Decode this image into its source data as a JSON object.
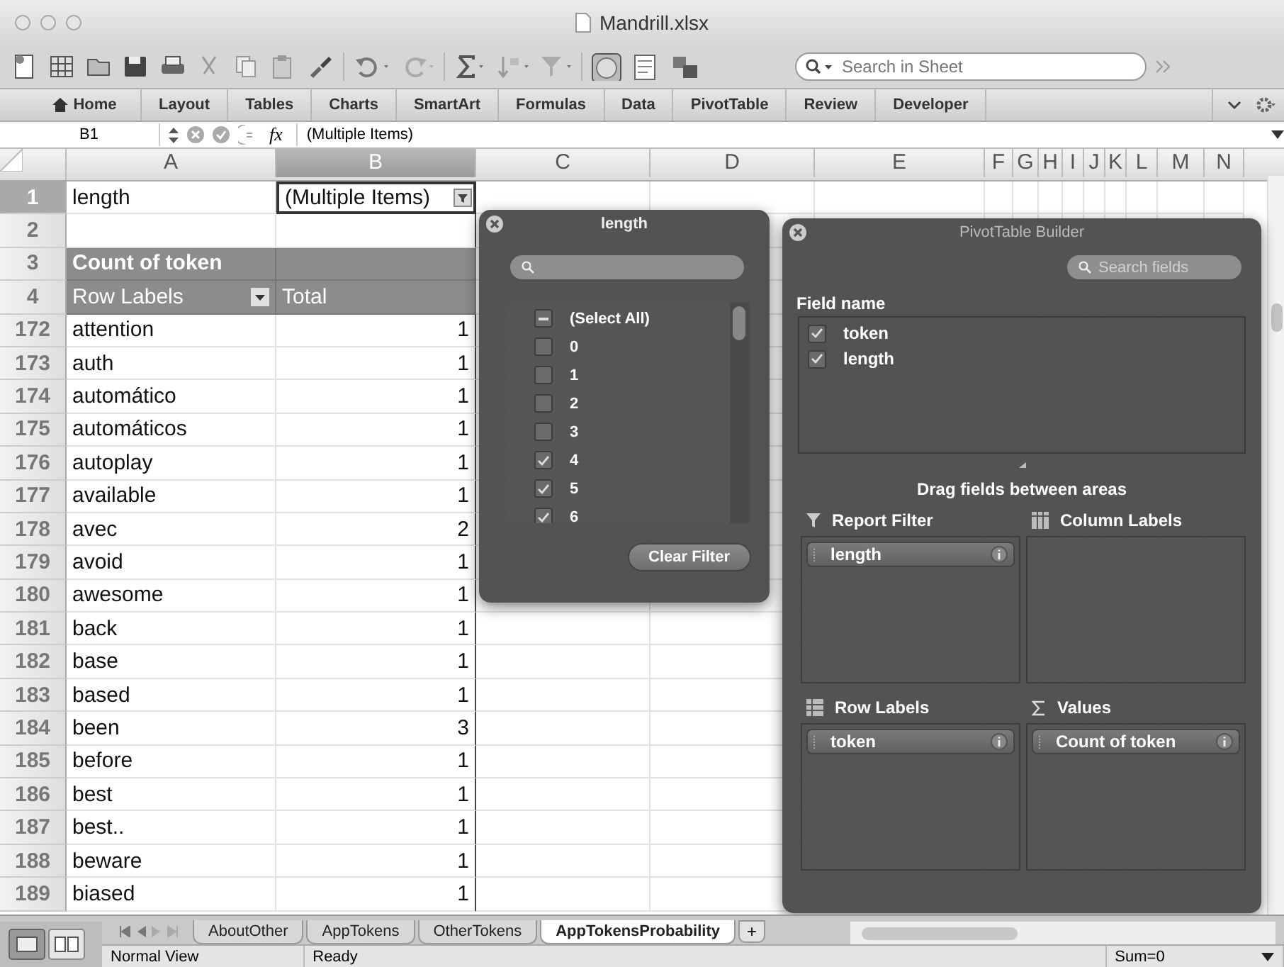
{
  "window": {
    "title": "Mandrill.xlsx"
  },
  "toolbar": {
    "search_placeholder": "Search in Sheet"
  },
  "ribbon": {
    "tabs": [
      {
        "label": "Home"
      },
      {
        "label": "Layout"
      },
      {
        "label": "Tables"
      },
      {
        "label": "Charts"
      },
      {
        "label": "SmartArt"
      },
      {
        "label": "Formulas"
      },
      {
        "label": "Data"
      },
      {
        "label": "PivotTable"
      },
      {
        "label": "Review"
      },
      {
        "label": "Developer"
      }
    ]
  },
  "formula_bar": {
    "name_box": "B1",
    "fx": "fx",
    "formula": "(Multiple Items)"
  },
  "sheet": {
    "columns": [
      {
        "label": "A",
        "selected": false
      },
      {
        "label": "B",
        "selected": true
      },
      {
        "label": "C",
        "selected": false
      },
      {
        "label": "D",
        "selected": false
      },
      {
        "label": "E",
        "selected": false
      },
      {
        "label": "F",
        "selected": false
      },
      {
        "label": "G",
        "selected": false
      },
      {
        "label": "H",
        "selected": false
      },
      {
        "label": "I",
        "selected": false
      },
      {
        "label": "J",
        "selected": false
      },
      {
        "label": "K",
        "selected": false
      },
      {
        "label": "L",
        "selected": false
      },
      {
        "label": "M",
        "selected": false
      },
      {
        "label": "N",
        "selected": false
      }
    ],
    "rows": [
      {
        "number": "1",
        "kind": "filter",
        "selected": true,
        "a": "length",
        "b": "(Multiple Items)"
      },
      {
        "number": "2",
        "kind": "blank",
        "selected": false
      },
      {
        "number": "3",
        "kind": "pivot_title",
        "selected": false,
        "a": "Count of token"
      },
      {
        "number": "4",
        "kind": "pivot_header",
        "selected": false,
        "a": "Row Labels",
        "b": "Total"
      },
      {
        "number": "172",
        "kind": "data",
        "selected": false,
        "a": "attention",
        "b": "1"
      },
      {
        "number": "173",
        "kind": "data",
        "selected": false,
        "a": "auth",
        "b": "1"
      },
      {
        "number": "174",
        "kind": "data",
        "selected": false,
        "a": "automático",
        "b": "1"
      },
      {
        "number": "175",
        "kind": "data",
        "selected": false,
        "a": "automáticos",
        "b": "1"
      },
      {
        "number": "176",
        "kind": "data",
        "selected": false,
        "a": "autoplay",
        "b": "1"
      },
      {
        "number": "177",
        "kind": "data",
        "selected": false,
        "a": "available",
        "b": "1"
      },
      {
        "number": "178",
        "kind": "data",
        "selected": false,
        "a": "avec",
        "b": "2"
      },
      {
        "number": "179",
        "kind": "data",
        "selected": false,
        "a": "avoid",
        "b": "1"
      },
      {
        "number": "180",
        "kind": "data",
        "selected": false,
        "a": "awesome",
        "b": "1"
      },
      {
        "number": "181",
        "kind": "data",
        "selected": false,
        "a": "back",
        "b": "1"
      },
      {
        "number": "182",
        "kind": "data",
        "selected": false,
        "a": "base",
        "b": "1"
      },
      {
        "number": "183",
        "kind": "data",
        "selected": false,
        "a": "based",
        "b": "1"
      },
      {
        "number": "184",
        "kind": "data",
        "selected": false,
        "a": "been",
        "b": "3"
      },
      {
        "number": "185",
        "kind": "data",
        "selected": false,
        "a": "before",
        "b": "1"
      },
      {
        "number": "186",
        "kind": "data",
        "selected": false,
        "a": "best",
        "b": "1"
      },
      {
        "number": "187",
        "kind": "data",
        "selected": false,
        "a": "best..",
        "b": "1"
      },
      {
        "number": "188",
        "kind": "data",
        "selected": false,
        "a": "beware",
        "b": "1"
      },
      {
        "number": "189",
        "kind": "data",
        "selected": false,
        "a": "biased",
        "b": "1"
      }
    ]
  },
  "filter_popup": {
    "title": "length",
    "items": [
      {
        "label": "(Select All)",
        "mixed": true
      },
      {
        "label": "0",
        "checked": false
      },
      {
        "label": "1",
        "checked": false
      },
      {
        "label": "2",
        "checked": false
      },
      {
        "label": "3",
        "checked": false
      },
      {
        "label": "4",
        "checked": true
      },
      {
        "label": "5",
        "checked": true
      },
      {
        "label": "6",
        "checked": true
      }
    ],
    "button": "Clear Filter"
  },
  "pivot_builder": {
    "title": "PivotTable Builder",
    "search_placeholder": "Search fields",
    "field_heading": "Field name",
    "fields": [
      {
        "label": "token",
        "checked": true
      },
      {
        "label": "length",
        "checked": true
      }
    ],
    "hint": "Drag fields between areas",
    "areas": [
      {
        "kind": "filter",
        "title": "Report Filter",
        "items": [
          "length"
        ]
      },
      {
        "kind": "columns",
        "title": "Column Labels"
      },
      {
        "kind": "rows",
        "title": "Row Labels",
        "items": [
          "token"
        ]
      },
      {
        "kind": "values",
        "title": "Values",
        "items": [
          "Count of token"
        ]
      }
    ]
  },
  "sheet_tabs": [
    {
      "label": "AboutOther",
      "selected": false
    },
    {
      "label": "AppTokens",
      "selected": false
    },
    {
      "label": "OtherTokens",
      "selected": false
    },
    {
      "label": "AppTokensProbability",
      "selected": true
    }
  ],
  "add_sheet": "+",
  "status_bar": {
    "view": "Normal View",
    "state": "Ready",
    "sum": "Sum=0"
  }
}
